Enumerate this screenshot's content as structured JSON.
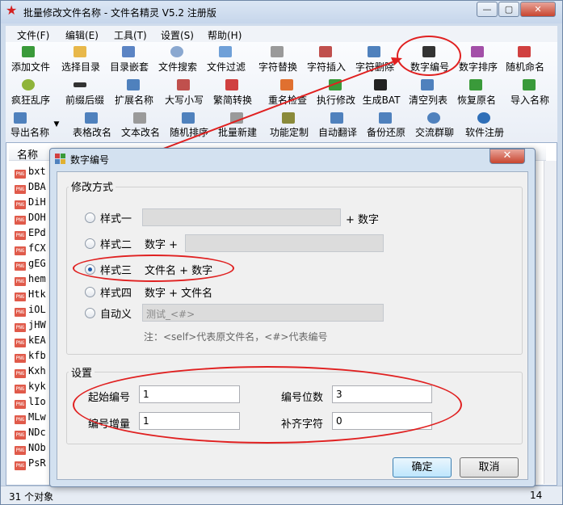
{
  "app": {
    "title": "批量修改文件名称 - 文件名精灵 V5.2 注册版",
    "window_buttons": [
      "—",
      "▢",
      "✕"
    ]
  },
  "menu": [
    "文件(F)",
    "编辑(E)",
    "工具(T)",
    "设置(S)",
    "帮助(H)"
  ],
  "toolbar": {
    "row1": [
      "添加文件",
      "选择目录",
      "目录嵌套",
      "文件搜索",
      "文件过滤",
      "字符替换",
      "字符插入",
      "字符删除",
      "数字编号",
      "数字排序",
      "随机命名"
    ],
    "row2": [
      "疯狂乱序",
      "前缀后缀",
      "扩展名称",
      "大写小写",
      "繁简转换",
      "重名检查",
      "执行修改",
      "生成BAT",
      "清空列表",
      "恢复原名",
      "导入名称"
    ],
    "row3": [
      "导出名称",
      "表格改名",
      "文本改名",
      "随机排序",
      "批量新建",
      "功能定制",
      "自动翻译",
      "备份还原",
      "交流群聊",
      "软件注册"
    ]
  },
  "list": {
    "column": "名称",
    "files": [
      "bxt",
      "DBA",
      "DiH",
      "DOH",
      "EPd",
      "fCX",
      "gEG",
      "hem",
      "Htk",
      "iOL",
      "jHW",
      "kEA",
      "kfb",
      "Kxh",
      "kyk",
      "lIo",
      "MLw",
      "NDc",
      "NOb",
      "PsR"
    ]
  },
  "status": {
    "count": "31 个对象",
    "right": "14"
  },
  "dialog": {
    "title": "数字编号",
    "close": "✕",
    "mode_group": "修改方式",
    "modes": [
      {
        "label": "样式一",
        "suffix": "+ 数字",
        "selected": false
      },
      {
        "label": "样式二",
        "prefix": "数字 +",
        "selected": false
      },
      {
        "label": "样式三",
        "desc": "文件名 + 数字",
        "selected": true
      },
      {
        "label": "样式四",
        "desc": "数字 + 文件名",
        "selected": false
      },
      {
        "label": "自动义",
        "value": "测试_<#>",
        "selected": false
      }
    ],
    "note": "注：<self>代表原文件名，<#>代表编号",
    "settings_group": "设置",
    "start_label": "起始编号",
    "start_value": "1",
    "digits_label": "编号位数",
    "digits_value": "3",
    "step_label": "编号增量",
    "step_value": "1",
    "pad_label": "补齐字符",
    "pad_value": "0",
    "ok": "确定",
    "cancel": "取消"
  },
  "colors": {
    "annotation": "#e02020",
    "dialog_frame": "#d3e1f0",
    "selected_radio": "#1f5aa8"
  }
}
